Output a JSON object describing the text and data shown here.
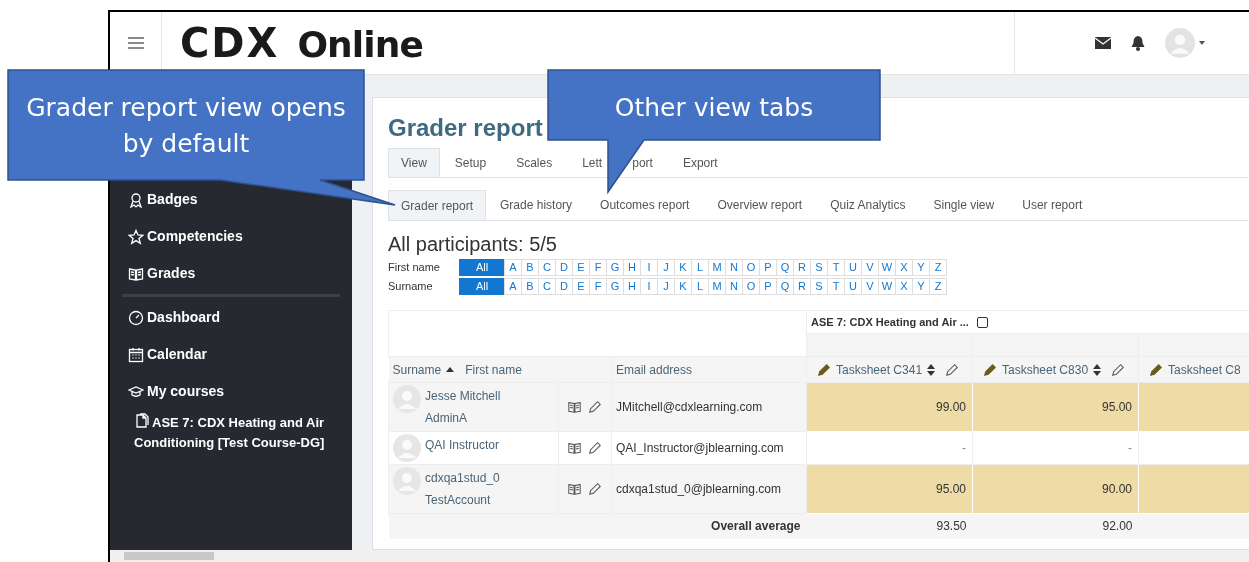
{
  "header": {
    "logo_main": "CDX",
    "logo_rest": "Online"
  },
  "sidebar": {
    "items": [
      {
        "label": "Badges",
        "kind": "badge"
      },
      {
        "label": "Competencies",
        "kind": "star"
      },
      {
        "label": "Grades",
        "kind": "book"
      },
      {
        "kind": "divider"
      },
      {
        "label": "Dashboard",
        "kind": "gauge"
      },
      {
        "label": "Calendar",
        "kind": "calendar"
      },
      {
        "label": "My courses",
        "kind": "cap",
        "children": [
          {
            "label": "ASE 7: CDX Heating and Air Conditioning [Test Course-DG]",
            "kind": "course"
          }
        ]
      }
    ]
  },
  "page": {
    "title": "Grader report",
    "tabs": [
      {
        "label": "View",
        "selected": true
      },
      {
        "label": "Setup",
        "selected": false
      },
      {
        "label": "Scales",
        "selected": false
      },
      {
        "label": "Lett",
        "selected": false
      },
      {
        "label": "port",
        "selected": false
      },
      {
        "label": "Export",
        "selected": false
      }
    ],
    "subtabs": [
      {
        "label": "Grader report",
        "selected": true
      },
      {
        "label": "Grade history",
        "selected": false
      },
      {
        "label": "Outcomes report",
        "selected": false
      },
      {
        "label": "Overview report",
        "selected": false
      },
      {
        "label": "Quiz Analytics",
        "selected": false
      },
      {
        "label": "Single view",
        "selected": false
      },
      {
        "label": "User report",
        "selected": false
      }
    ],
    "participants": "All participants: 5/5",
    "filters": [
      {
        "label": "First name",
        "letters": [
          {
            "text": "All",
            "selected": true
          },
          {
            "text": "A",
            "selected": false
          },
          {
            "text": "B",
            "selected": false
          },
          {
            "text": "C",
            "selected": false
          },
          {
            "text": "D",
            "selected": false
          },
          {
            "text": "E",
            "selected": false
          },
          {
            "text": "F",
            "selected": false
          },
          {
            "text": "G",
            "selected": false
          },
          {
            "text": "H",
            "selected": false
          },
          {
            "text": "I",
            "selected": false
          },
          {
            "text": "J",
            "selected": false
          },
          {
            "text": "K",
            "selected": false
          },
          {
            "text": "L",
            "selected": false
          },
          {
            "text": "M",
            "selected": false
          },
          {
            "text": "N",
            "selected": false
          },
          {
            "text": "O",
            "selected": false
          },
          {
            "text": "P",
            "selected": false
          },
          {
            "text": "Q",
            "selected": false
          },
          {
            "text": "R",
            "selected": false
          },
          {
            "text": "S",
            "selected": false
          },
          {
            "text": "T",
            "selected": false
          },
          {
            "text": "U",
            "selected": false
          },
          {
            "text": "V",
            "selected": false
          },
          {
            "text": "W",
            "selected": false
          },
          {
            "text": "X",
            "selected": false
          },
          {
            "text": "Y",
            "selected": false
          },
          {
            "text": "Z",
            "selected": false
          }
        ]
      },
      {
        "label": "Surname",
        "letters": [
          {
            "text": "All",
            "selected": true
          },
          {
            "text": "A",
            "selected": false
          },
          {
            "text": "B",
            "selected": false
          },
          {
            "text": "C",
            "selected": false
          },
          {
            "text": "D",
            "selected": false
          },
          {
            "text": "E",
            "selected": false
          },
          {
            "text": "F",
            "selected": false
          },
          {
            "text": "G",
            "selected": false
          },
          {
            "text": "H",
            "selected": false
          },
          {
            "text": "I",
            "selected": false
          },
          {
            "text": "J",
            "selected": false
          },
          {
            "text": "K",
            "selected": false
          },
          {
            "text": "L",
            "selected": false
          },
          {
            "text": "M",
            "selected": false
          },
          {
            "text": "N",
            "selected": false
          },
          {
            "text": "O",
            "selected": false
          },
          {
            "text": "P",
            "selected": false
          },
          {
            "text": "Q",
            "selected": false
          },
          {
            "text": "R",
            "selected": false
          },
          {
            "text": "S",
            "selected": false
          },
          {
            "text": "T",
            "selected": false
          },
          {
            "text": "U",
            "selected": false
          },
          {
            "text": "V",
            "selected": false
          },
          {
            "text": "W",
            "selected": false
          },
          {
            "text": "X",
            "selected": false
          },
          {
            "text": "Y",
            "selected": false
          },
          {
            "text": "Z",
            "selected": false
          }
        ]
      }
    ],
    "table": {
      "category": {
        "label": "ASE 7: CDX Heating and Air ...",
        "checked": false
      },
      "columns": {
        "surname": "Surname",
        "first_name": "First name",
        "email": "Email address",
        "grades": [
          {
            "label": "Tasksheet C341",
            "sortable": true
          },
          {
            "label": "Tasksheet C830",
            "sortable": true
          },
          {
            "label": "Tasksheet C8",
            "sortable": false
          }
        ]
      },
      "rows": [
        {
          "name": "Jesse Mitchell AdminA",
          "email": "JMitchell@cdxlearning.com",
          "grades": [
            {
              "value": "99.00",
              "highlighted": true
            },
            {
              "value": "95.00",
              "highlighted": true
            },
            {
              "highlighted": true
            }
          ]
        },
        {
          "name": "QAI Instructor",
          "email": "QAI_Instructor@jblearning.com",
          "grades": [
            {
              "value": "-",
              "highlighted": false
            },
            {
              "value": "-",
              "highlighted": false
            },
            {
              "highlighted": false
            }
          ]
        },
        {
          "name": "cdxqa1stud_0 TestAccount",
          "email": "cdxqa1stud_0@jblearning.com",
          "grades": [
            {
              "value": "95.00",
              "highlighted": true
            },
            {
              "value": "90.00",
              "highlighted": true
            },
            {
              "highlighted": true
            }
          ]
        }
      ],
      "average": {
        "label": "Overall average",
        "values": [
          "93.50",
          "92.00"
        ]
      }
    }
  },
  "callouts": [
    {
      "text": "Grader report view opens by default"
    },
    {
      "text": "Other view tabs"
    }
  ]
}
